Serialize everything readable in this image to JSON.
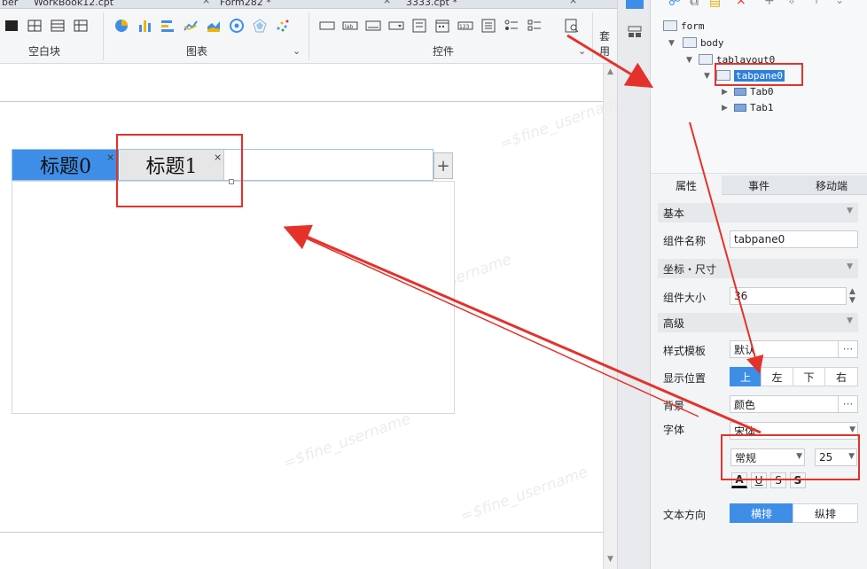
{
  "filetabs": [
    {
      "label": "ber"
    },
    {
      "label": "WorkBook12.cpt"
    },
    {
      "label": "Form282 *"
    },
    {
      "label": "3333.cpt *"
    }
  ],
  "ribbon": {
    "groups": [
      {
        "label": "空白块"
      },
      {
        "label": "图表"
      },
      {
        "label": "控件"
      },
      {
        "label": "套用"
      }
    ]
  },
  "canvas": {
    "tabs": [
      {
        "label": "标题0",
        "close": "×"
      },
      {
        "label": "标题1",
        "close": "×"
      }
    ],
    "add_tab": "+",
    "watermark": "=$fine_username"
  },
  "tree": {
    "nodes": [
      {
        "label": "form"
      },
      {
        "label": "body"
      },
      {
        "label": "tablayout0"
      },
      {
        "label": "tabpane0"
      },
      {
        "label": "Tab0"
      },
      {
        "label": "Tab1"
      }
    ]
  },
  "panel": {
    "tabs": [
      "属性",
      "事件",
      "移动端"
    ],
    "sections": {
      "basic": "基本",
      "coord": "坐标・尺寸",
      "advanced": "高级"
    },
    "fields": {
      "name_label": "组件名称",
      "name_value": "tabpane0",
      "size_label": "组件大小",
      "size_value": "36",
      "style_label": "样式模板",
      "style_value": "默认",
      "position_label": "显示位置",
      "position_options": [
        "上",
        "左",
        "下",
        "右"
      ],
      "position_selected": "上",
      "bg_label": "背景",
      "bg_value": "颜色",
      "font_label": "字体",
      "font_family": "宋体",
      "font_style": "常规",
      "font_size": "25",
      "format_buttons": [
        "A",
        "U",
        "S",
        "S"
      ],
      "direction_label": "文本方向",
      "direction_options": [
        "横排",
        "纵排"
      ],
      "direction_selected": "横排"
    }
  },
  "colors": {
    "accent": "#3e8ee8",
    "annotation": "#e4322b"
  }
}
